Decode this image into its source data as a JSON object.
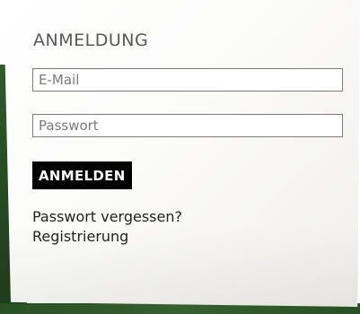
{
  "login": {
    "heading": "ANMELDUNG",
    "email_placeholder": "E-Mail",
    "password_placeholder": "Passwort",
    "submit_label": "ANMELDEN",
    "forgot_password_label": "Passwort vergessen?",
    "register_label": "Registrierung"
  },
  "colors": {
    "paper": "#ffffff",
    "button_bg": "#000000",
    "button_text": "#ffffff",
    "heading_text": "#585858",
    "background_green": "#2f5a2a"
  }
}
